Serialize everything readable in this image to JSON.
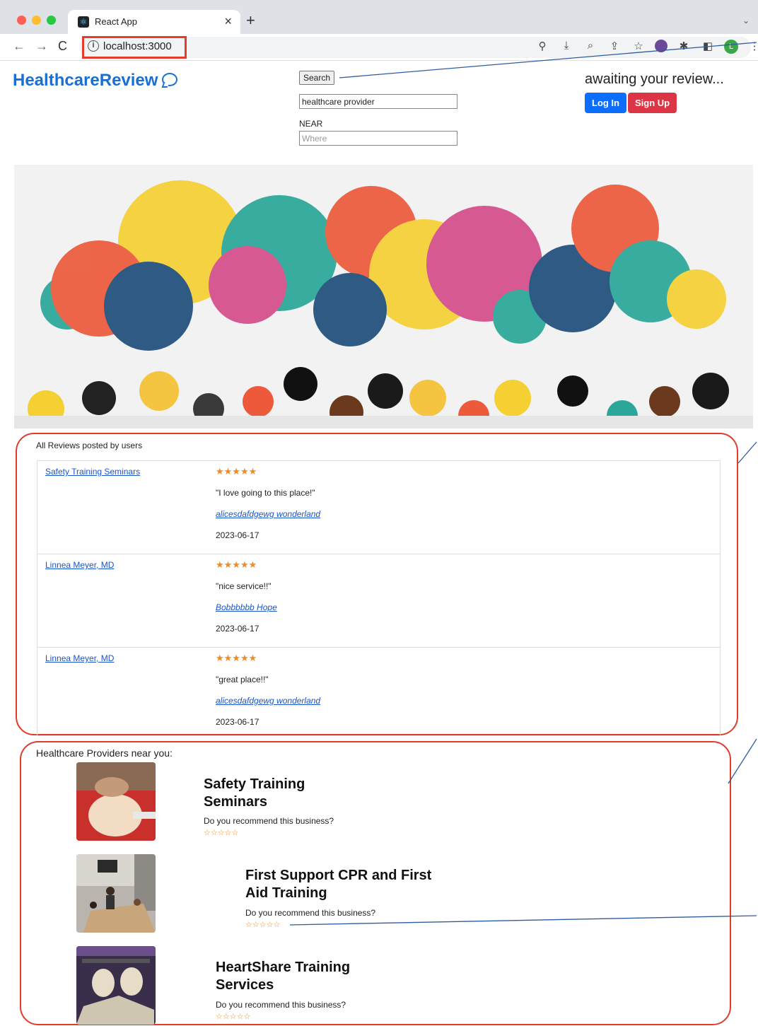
{
  "browser": {
    "tab_title": "React App",
    "tab_close": "×",
    "new_tab": "+",
    "tab_menu": "⌄",
    "back": "←",
    "forward": "→",
    "reload": "C",
    "info": "i",
    "url": "localhost:3000",
    "profile_initial": "L"
  },
  "header": {
    "brand": "HealthcareReview",
    "search_label": "Search",
    "what_value": "healthcare provider",
    "near_label": "NEAR",
    "where_placeholder": "Where",
    "greeting": "awaiting your review...",
    "login_label": "Log In",
    "signup_label": "Sign Up"
  },
  "reviews": {
    "title": "All Reviews posted by users",
    "items": [
      {
        "provider": "Safety Training Seminars",
        "stars": "★★★★★",
        "rating": 5,
        "text": "\"I love going to this place!\"",
        "user": "alicesdafdgewg wonderland",
        "date": "2023-06-17"
      },
      {
        "provider": "Linnea Meyer, MD",
        "stars": "★★★★★",
        "rating": 5,
        "text": "\"nice service!!\"",
        "user": "Bobbbbbb Hope",
        "date": "2023-06-17"
      },
      {
        "provider": "Linnea Meyer, MD",
        "stars": "★★★★★",
        "rating": 5,
        "text": "\"great place!!\"",
        "user": "alicesdafdgewg wonderland",
        "date": "2023-06-17"
      }
    ]
  },
  "providers": {
    "title": "Healthcare Providers near you:",
    "items": [
      {
        "name_line1": "Safety Training",
        "name_line2": "Seminars",
        "question": "Do you recommend this business?",
        "stars": "☆☆☆☆☆"
      },
      {
        "name_line1": "First Support CPR and First",
        "name_line2": "Aid Training",
        "question": "Do you recommend this business?",
        "stars": "☆☆☆☆☆"
      },
      {
        "name_line1": "HeartShare Training",
        "name_line2": "Services",
        "question": "Do you recommend this business?",
        "stars": "☆☆☆☆☆"
      }
    ]
  },
  "colors": {
    "brand": "#1a6fd6",
    "login": "#0d6efd",
    "signup": "#dc3545",
    "star": "#f08a24",
    "annotation_box": "#e03c2c"
  }
}
